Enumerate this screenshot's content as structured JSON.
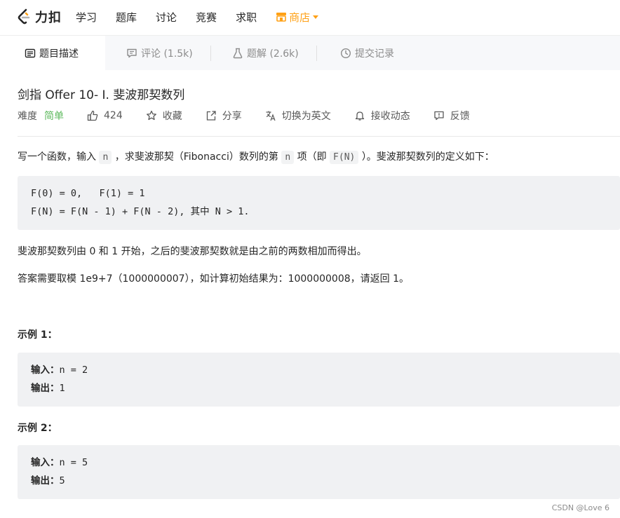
{
  "nav": {
    "logo_text": "力扣",
    "items": [
      "学习",
      "题库",
      "讨论",
      "竞赛",
      "求职"
    ],
    "store": "商店"
  },
  "tabs": [
    {
      "label": "题目描述"
    },
    {
      "label": "评论 (1.5k)"
    },
    {
      "label": "题解 (2.6k)"
    },
    {
      "label": "提交记录"
    }
  ],
  "problem": {
    "title": "剑指 Offer 10- I. 斐波那契数列",
    "difficulty_label": "难度",
    "difficulty": "简单",
    "likes": "424",
    "actions": [
      "收藏",
      "分享",
      "切换为英文",
      "接收动态",
      "反馈"
    ]
  },
  "content": {
    "intro": {
      "p1": "写一个函数，输入",
      "c1": "n",
      "p2": "，求斐波那契（Fibonacci）数列的第",
      "c2": "n",
      "p3": "项（即",
      "c3": "F(N)",
      "p4": "）。斐波那契数列的定义如下："
    },
    "definition": [
      "F(0) = 0,   F(1) = 1",
      "F(N) = F(N - 1) + F(N - 2), 其中 N > 1."
    ],
    "para2": "斐波那契数列由 0 和 1 开始，之后的斐波那契数就是由之前的两数相加而得出。",
    "para3": "答案需要取模 1e9+7（1000000007），如计算初始结果为：1000000008，请返回 1。",
    "examples": [
      {
        "title": "示例 1：",
        "input_label": "输入：",
        "input": "n = 2",
        "output_label": "输出：",
        "output": "1"
      },
      {
        "title": "示例 2：",
        "input_label": "输入：",
        "input": "n = 5",
        "output_label": "输出：",
        "output": "5"
      }
    ]
  },
  "watermark": "CSDN @Love 6",
  "colors": {
    "accent": "#ffa116",
    "easy": "#5cb85c"
  }
}
